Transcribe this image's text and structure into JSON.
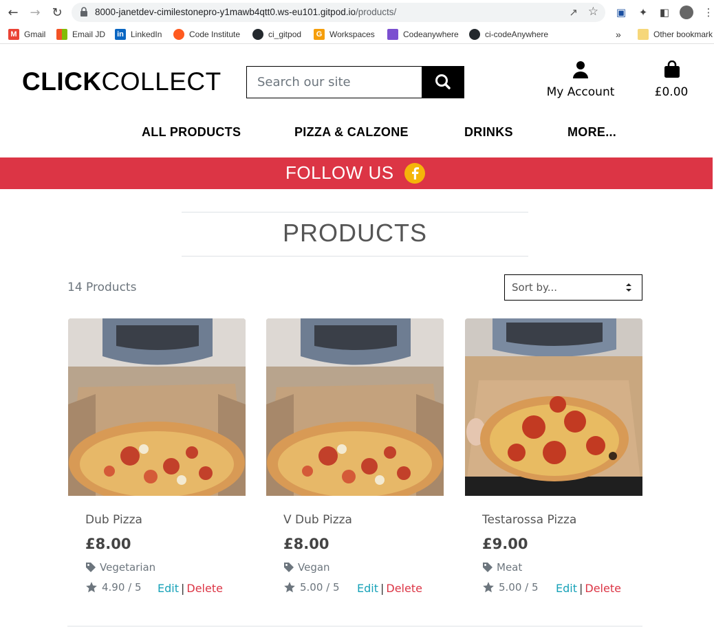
{
  "browser": {
    "url_host": "8000-janetdev-cimilestonepro-y1mawb4qtt0.ws-eu101.gitpod.io",
    "url_path": "/products/",
    "bookmarks": [
      {
        "label": "Gmail",
        "icon": "gmail-icon",
        "color": "#ea4335"
      },
      {
        "label": "Email JD",
        "icon": "windows-icon",
        "color": "#f35325"
      },
      {
        "label": "LinkedIn",
        "icon": "linkedin-icon",
        "color": "#0a66c2"
      },
      {
        "label": "Code Institute",
        "icon": "code-institute-icon",
        "color": "#ff5a1f"
      },
      {
        "label": "ci_gitpod",
        "icon": "github-icon",
        "color": "#24292e"
      },
      {
        "label": "Workspaces",
        "icon": "gitpod-icon",
        "color": "#f59e0b"
      },
      {
        "label": "Codeanywhere",
        "icon": "codeanywhere-icon",
        "color": "#7b4fd0"
      },
      {
        "label": "ci-codeAnywhere",
        "icon": "github-icon",
        "color": "#24292e"
      }
    ],
    "overflow": "»",
    "other_bookmarks": "Other bookmark"
  },
  "header": {
    "logo_bold": "CLICK",
    "logo_light": "COLLECT",
    "search_placeholder": "Search our site",
    "account_label": "My Account",
    "bag_total": "£0.00"
  },
  "nav": {
    "items": [
      "ALL PRODUCTS",
      "PIZZA & CALZONE",
      "DRINKS",
      "MORE..."
    ]
  },
  "banner": {
    "text": "FOLLOW US",
    "color": "#dc3545"
  },
  "main": {
    "title": "PRODUCTS",
    "count": "14 Products",
    "sort_value": "Sort by..."
  },
  "products": [
    {
      "name": "Dub Pizza",
      "price": "£8.00",
      "category": "Vegetarian",
      "rating": "4.90 / 5",
      "edit": "Edit",
      "sep": "|",
      "delete": "Delete"
    },
    {
      "name": "V Dub Pizza",
      "price": "£8.00",
      "category": "Vegan",
      "rating": "5.00 / 5",
      "edit": "Edit",
      "sep": "|",
      "delete": "Delete"
    },
    {
      "name": "Testarossa Pizza",
      "price": "£9.00",
      "category": "Meat",
      "rating": "5.00 / 5",
      "edit": "Edit",
      "sep": "|",
      "delete": "Delete"
    }
  ]
}
